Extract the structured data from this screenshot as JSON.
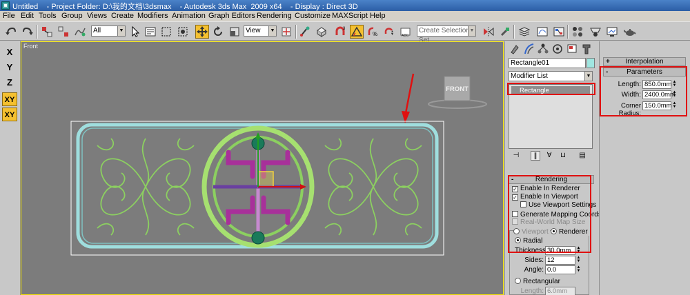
{
  "window": {
    "title": "Untitled    - Project Folder: D:\\我的文档\\3dsmax    - Autodesk 3ds Max  2009 x64    - Display : Direct 3D"
  },
  "menu": [
    "File",
    "Edit",
    "Tools",
    "Group",
    "Views",
    "Create",
    "Modifiers",
    "Animation",
    "Graph Editors",
    "Rendering",
    "Customize",
    "MAXScript",
    "Help"
  ],
  "toolbar": {
    "filter_value": "All",
    "refcoord_value": "View",
    "selection_set_placeholder": "Create Selection Set"
  },
  "axis_buttons": [
    "X",
    "Y",
    "Z",
    "XY",
    "XY"
  ],
  "viewport": {
    "label": "Front",
    "viewcube_label": "FRONT"
  },
  "command_panel": {
    "object_name": "Rectangle01",
    "modifier_list": "Modifier List",
    "stack_item": "Rectangle",
    "rendering": {
      "title": "Rendering",
      "sign": "-",
      "enable_in_renderer": "Enable In Renderer",
      "enable_in_viewport": "Enable In Viewport",
      "use_viewport_settings": "Use Viewport Settings",
      "generate_mapping": "Generate Mapping Coords.",
      "real_world_map": "Real-World Map Size",
      "viewport_radio": "Viewport",
      "renderer_radio": "Renderer",
      "radial": "Radial",
      "thickness_label": "Thickness:",
      "thickness_value": "30.0mm",
      "sides_label": "Sides:",
      "sides_value": "12",
      "angle_label": "Angle:",
      "angle_value": "0.0",
      "rectangular": "Rectangular",
      "length_label": "Length:",
      "length_value": "6.0mm"
    }
  },
  "right_panel": {
    "interpolation": {
      "title": "Interpolation",
      "sign": "+"
    },
    "parameters": {
      "title": "Parameters",
      "sign": "-",
      "length_label": "Length:",
      "length_value": "850.0mm",
      "width_label": "Width:",
      "width_value": "2400.0mm",
      "corner_label": "Corner Radius:",
      "corner_value": "150.0mm"
    }
  },
  "colors": {
    "object_color": "#a0e6e0",
    "highlight_red": "#e01010",
    "active_yellow": "#f4c030",
    "frame_cyan": "#9fdede",
    "ornament_green": "#8cd060",
    "cross_magenta": "#a8309a"
  }
}
